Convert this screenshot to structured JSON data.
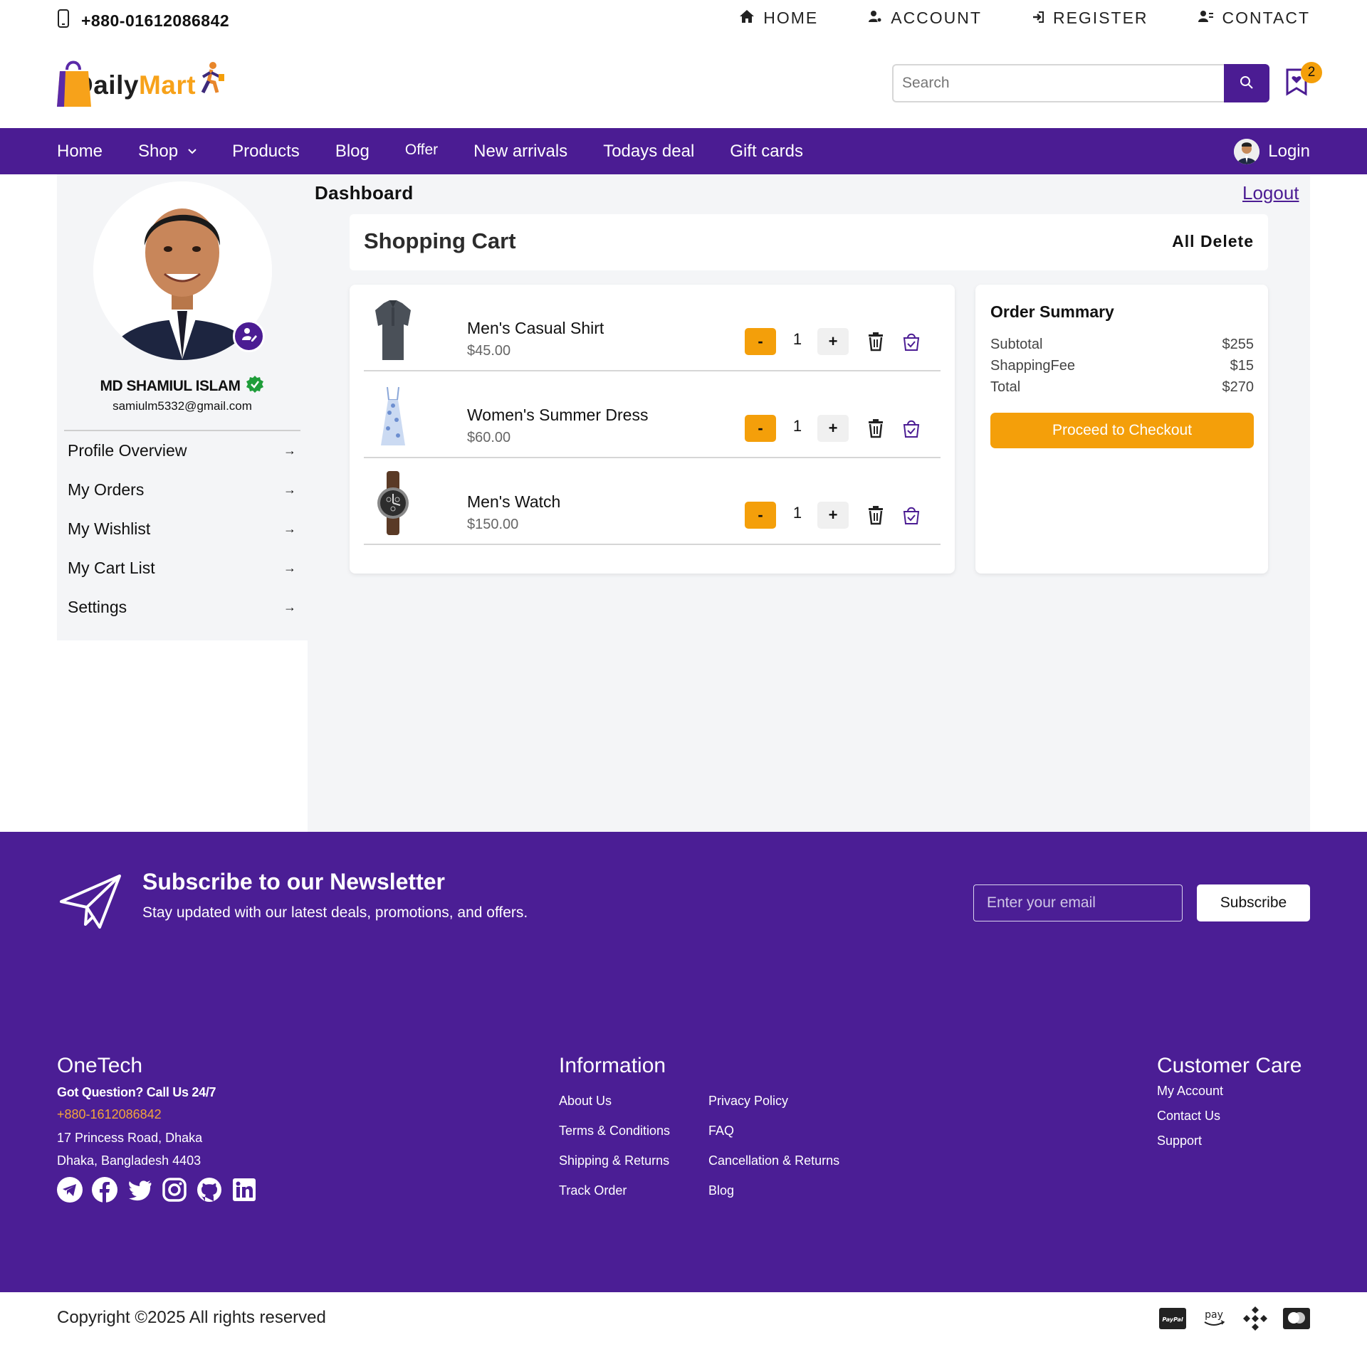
{
  "topbar": {
    "phone": "+880-01612086842",
    "links": {
      "home": "HOME",
      "account": "ACCOUNT",
      "register": "REGISTER",
      "contact": "CONTACT"
    }
  },
  "logo": {
    "part1": "Daily",
    "part2": "Mart"
  },
  "search": {
    "placeholder": "Search"
  },
  "wishlist": {
    "count": "2"
  },
  "nav": {
    "home": "Home",
    "shop": "Shop",
    "products": "Products",
    "blog": "Blog",
    "offer": "Offer",
    "new_arrivals": "New arrivals",
    "todays_deal": "Todays deal",
    "gift_cards": "Gift cards",
    "login": "Login"
  },
  "profile": {
    "name": "MD SHAMIUL ISLAM",
    "email": "samiulm5332@gmail.com",
    "menu": [
      "Profile Overview",
      "My Orders",
      "My Wishlist",
      "My Cart List",
      "Settings"
    ],
    "arrow": "→"
  },
  "dashboard": {
    "title": "Dashboard",
    "logout": "Logout"
  },
  "cart": {
    "title": "Shopping Cart",
    "delete_all": "All Delete",
    "items": [
      {
        "name": "Men's Casual Shirt",
        "price": "$45.00",
        "qty": "1",
        "icon": "shirt-image"
      },
      {
        "name": "Women's Summer Dress",
        "price": "$60.00",
        "qty": "1",
        "icon": "dress-image"
      },
      {
        "name": "Men's Watch",
        "price": "$150.00",
        "qty": "1",
        "icon": "watch-image"
      }
    ],
    "minus": "-",
    "plus": "+"
  },
  "summary": {
    "title": "Order Summary",
    "subtotal_label": "Subtotal",
    "subtotal": "$255",
    "fee_label": "ShappingFee",
    "fee": "$15",
    "total_label": "Total",
    "total": "$270",
    "checkout": "Proceed to Checkout"
  },
  "newsletter": {
    "title": "Subscribe to our Newsletter",
    "subtitle": "Stay updated with our latest deals, promotions, and offers.",
    "placeholder": "Enter your email",
    "button": "Subscribe"
  },
  "footer": {
    "brand": "OneTech",
    "question": "Got Question? Call Us 24/7",
    "phone": "+880-1612086842",
    "address1": "17 Princess Road, Dhaka",
    "address2": "Dhaka, Bangladesh 4403",
    "info_title": "Information",
    "info_links": [
      "About Us",
      "Privacy Policy",
      "Terms & Conditions",
      "FAQ",
      "Shipping & Returns",
      "Cancellation & Returns",
      "Track Order",
      "Blog"
    ],
    "care_title": "Customer Care",
    "care_links": [
      "My Account",
      "Contact Us",
      "Support"
    ],
    "socials": [
      "telegram-icon",
      "facebook-icon",
      "twitter-icon",
      "instagram-icon",
      "github-icon",
      "linkedin-icon"
    ]
  },
  "copyright": "Copyright ©2025 All rights reserved",
  "payments": {
    "paypal": "PayPal",
    "amazon": "pay"
  },
  "colors": {
    "brand": "#4b1c93",
    "accent": "#f49f0a",
    "panel": "#f4f5f7"
  }
}
